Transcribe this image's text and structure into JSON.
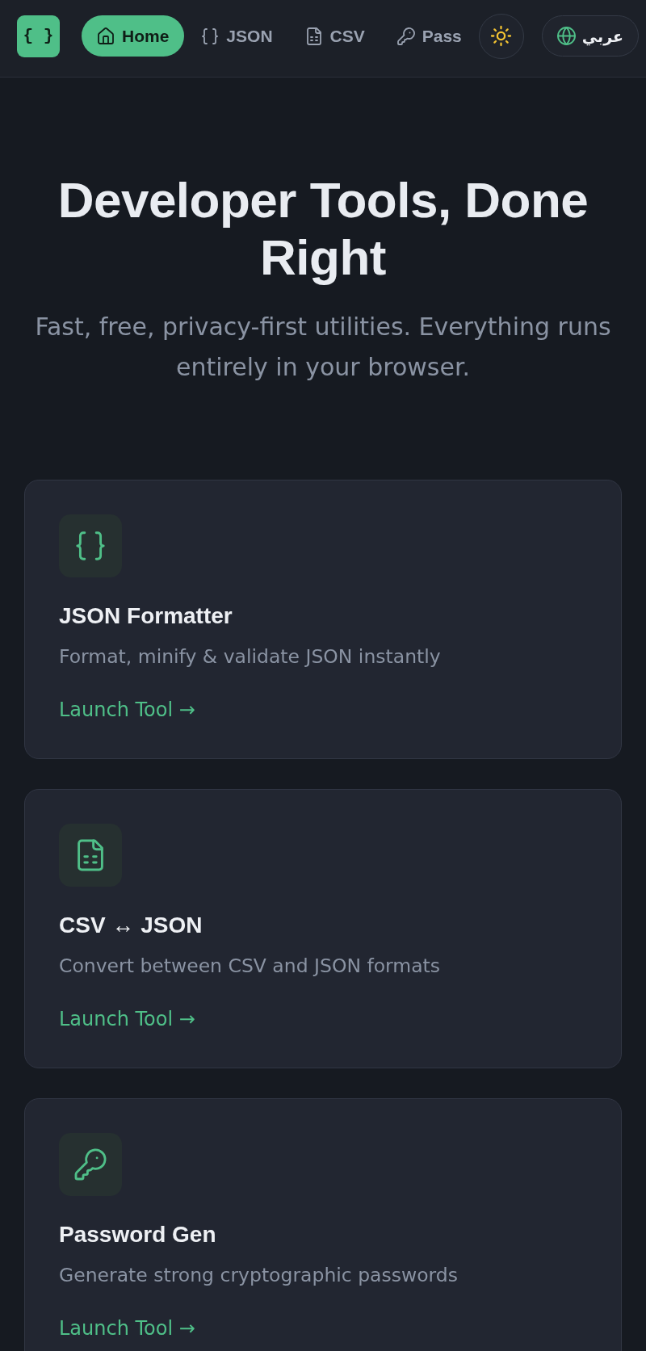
{
  "nav": {
    "logo": "{ }",
    "items": [
      {
        "kind": "home",
        "label": "Home",
        "selected": true
      },
      {
        "kind": "braces",
        "label": "JSON",
        "selected": false
      },
      {
        "kind": "sheet",
        "label": "CSV",
        "selected": false
      },
      {
        "kind": "key",
        "label": "Pass",
        "selected": false
      }
    ],
    "language": {
      "label": "عربي"
    }
  },
  "hero": {
    "title": "Developer Tools, Done Right",
    "subtitle": "Fast, free, privacy-first utilities. Everything runs entirely in your browser."
  },
  "tools": [
    {
      "kind": "braces",
      "title": "JSON Formatter",
      "description": "Format, minify & validate JSON instantly",
      "link": "Launch Tool →"
    },
    {
      "kind": "sheet",
      "title": "CSV ↔ JSON",
      "description": "Convert between CSV and JSON formats",
      "link": "Launch Tool →"
    },
    {
      "kind": "key",
      "title": "Password Gen",
      "description": "Generate strong cryptographic passwords",
      "link": "Launch Tool →"
    }
  ]
}
